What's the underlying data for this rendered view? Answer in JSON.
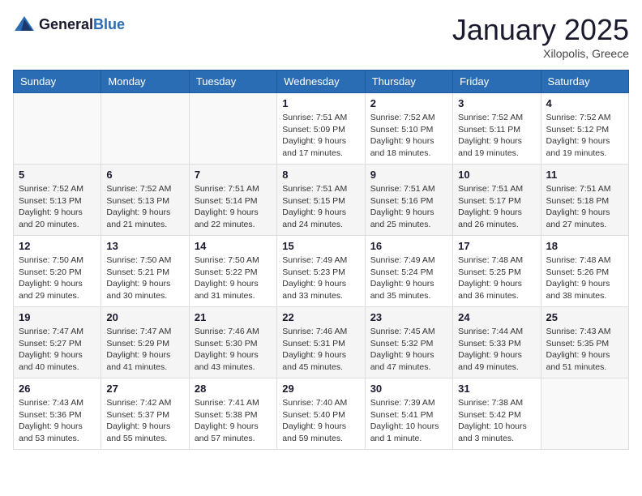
{
  "header": {
    "logo": {
      "general": "General",
      "blue": "Blue"
    },
    "title": "January 2025",
    "subtitle": "Xilopolis, Greece"
  },
  "calendar": {
    "headers": [
      "Sunday",
      "Monday",
      "Tuesday",
      "Wednesday",
      "Thursday",
      "Friday",
      "Saturday"
    ],
    "weeks": [
      [
        {
          "day": "",
          "info": ""
        },
        {
          "day": "",
          "info": ""
        },
        {
          "day": "",
          "info": ""
        },
        {
          "day": "1",
          "info": "Sunrise: 7:51 AM\nSunset: 5:09 PM\nDaylight: 9 hours\nand 17 minutes."
        },
        {
          "day": "2",
          "info": "Sunrise: 7:52 AM\nSunset: 5:10 PM\nDaylight: 9 hours\nand 18 minutes."
        },
        {
          "day": "3",
          "info": "Sunrise: 7:52 AM\nSunset: 5:11 PM\nDaylight: 9 hours\nand 19 minutes."
        },
        {
          "day": "4",
          "info": "Sunrise: 7:52 AM\nSunset: 5:12 PM\nDaylight: 9 hours\nand 19 minutes."
        }
      ],
      [
        {
          "day": "5",
          "info": "Sunrise: 7:52 AM\nSunset: 5:13 PM\nDaylight: 9 hours\nand 20 minutes."
        },
        {
          "day": "6",
          "info": "Sunrise: 7:52 AM\nSunset: 5:13 PM\nDaylight: 9 hours\nand 21 minutes."
        },
        {
          "day": "7",
          "info": "Sunrise: 7:51 AM\nSunset: 5:14 PM\nDaylight: 9 hours\nand 22 minutes."
        },
        {
          "day": "8",
          "info": "Sunrise: 7:51 AM\nSunset: 5:15 PM\nDaylight: 9 hours\nand 24 minutes."
        },
        {
          "day": "9",
          "info": "Sunrise: 7:51 AM\nSunset: 5:16 PM\nDaylight: 9 hours\nand 25 minutes."
        },
        {
          "day": "10",
          "info": "Sunrise: 7:51 AM\nSunset: 5:17 PM\nDaylight: 9 hours\nand 26 minutes."
        },
        {
          "day": "11",
          "info": "Sunrise: 7:51 AM\nSunset: 5:18 PM\nDaylight: 9 hours\nand 27 minutes."
        }
      ],
      [
        {
          "day": "12",
          "info": "Sunrise: 7:50 AM\nSunset: 5:20 PM\nDaylight: 9 hours\nand 29 minutes."
        },
        {
          "day": "13",
          "info": "Sunrise: 7:50 AM\nSunset: 5:21 PM\nDaylight: 9 hours\nand 30 minutes."
        },
        {
          "day": "14",
          "info": "Sunrise: 7:50 AM\nSunset: 5:22 PM\nDaylight: 9 hours\nand 31 minutes."
        },
        {
          "day": "15",
          "info": "Sunrise: 7:49 AM\nSunset: 5:23 PM\nDaylight: 9 hours\nand 33 minutes."
        },
        {
          "day": "16",
          "info": "Sunrise: 7:49 AM\nSunset: 5:24 PM\nDaylight: 9 hours\nand 35 minutes."
        },
        {
          "day": "17",
          "info": "Sunrise: 7:48 AM\nSunset: 5:25 PM\nDaylight: 9 hours\nand 36 minutes."
        },
        {
          "day": "18",
          "info": "Sunrise: 7:48 AM\nSunset: 5:26 PM\nDaylight: 9 hours\nand 38 minutes."
        }
      ],
      [
        {
          "day": "19",
          "info": "Sunrise: 7:47 AM\nSunset: 5:27 PM\nDaylight: 9 hours\nand 40 minutes."
        },
        {
          "day": "20",
          "info": "Sunrise: 7:47 AM\nSunset: 5:29 PM\nDaylight: 9 hours\nand 41 minutes."
        },
        {
          "day": "21",
          "info": "Sunrise: 7:46 AM\nSunset: 5:30 PM\nDaylight: 9 hours\nand 43 minutes."
        },
        {
          "day": "22",
          "info": "Sunrise: 7:46 AM\nSunset: 5:31 PM\nDaylight: 9 hours\nand 45 minutes."
        },
        {
          "day": "23",
          "info": "Sunrise: 7:45 AM\nSunset: 5:32 PM\nDaylight: 9 hours\nand 47 minutes."
        },
        {
          "day": "24",
          "info": "Sunrise: 7:44 AM\nSunset: 5:33 PM\nDaylight: 9 hours\nand 49 minutes."
        },
        {
          "day": "25",
          "info": "Sunrise: 7:43 AM\nSunset: 5:35 PM\nDaylight: 9 hours\nand 51 minutes."
        }
      ],
      [
        {
          "day": "26",
          "info": "Sunrise: 7:43 AM\nSunset: 5:36 PM\nDaylight: 9 hours\nand 53 minutes."
        },
        {
          "day": "27",
          "info": "Sunrise: 7:42 AM\nSunset: 5:37 PM\nDaylight: 9 hours\nand 55 minutes."
        },
        {
          "day": "28",
          "info": "Sunrise: 7:41 AM\nSunset: 5:38 PM\nDaylight: 9 hours\nand 57 minutes."
        },
        {
          "day": "29",
          "info": "Sunrise: 7:40 AM\nSunset: 5:40 PM\nDaylight: 9 hours\nand 59 minutes."
        },
        {
          "day": "30",
          "info": "Sunrise: 7:39 AM\nSunset: 5:41 PM\nDaylight: 10 hours\nand 1 minute."
        },
        {
          "day": "31",
          "info": "Sunrise: 7:38 AM\nSunset: 5:42 PM\nDaylight: 10 hours\nand 3 minutes."
        },
        {
          "day": "",
          "info": ""
        }
      ]
    ]
  }
}
